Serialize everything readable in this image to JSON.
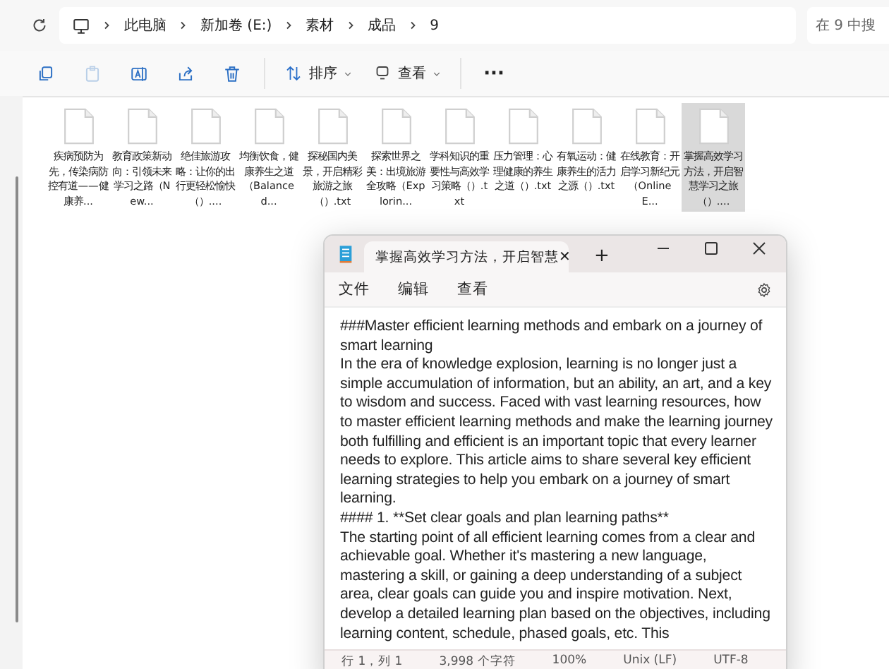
{
  "address_bar": {
    "crumbs": [
      "此电脑",
      "新加卷 (E:)",
      "素材",
      "成品",
      "9"
    ],
    "search": {
      "placeholder": "在 9 中搜"
    }
  },
  "toolbar": {
    "items": [
      {
        "kind": "copy",
        "disabled": false
      },
      {
        "kind": "paste",
        "disabled": true
      },
      {
        "kind": "rename",
        "disabled": false
      },
      {
        "kind": "share",
        "disabled": false
      },
      {
        "kind": "delete",
        "disabled": false
      }
    ],
    "sort": "排序",
    "view": "查看",
    "more": "···"
  },
  "files": [
    {
      "name": "疾病预防为先，传染病防控有道——健康养...",
      "selected": false
    },
    {
      "name": "教育政策新动向：引领未来学习之路（New...",
      "selected": false
    },
    {
      "name": "绝佳旅游攻略：让你的出行更轻松愉快（）....",
      "selected": false
    },
    {
      "name": "均衡饮食，健康养生之道（Balanced...",
      "selected": false
    },
    {
      "name": "探秘国内美景，开启精彩旅游之旅（）.txt",
      "selected": false
    },
    {
      "name": "探索世界之美：出境旅游全攻略（Explorin...",
      "selected": false
    },
    {
      "name": "学科知识的重要性与高效学习策略（）.txt",
      "selected": false
    },
    {
      "name": "压力管理：心理健康的养生之道（）.txt",
      "selected": false
    },
    {
      "name": "有氧运动：健康养生的活力之源（）.txt",
      "selected": false
    },
    {
      "name": "在线教育：开启学习新纪元（Online E...",
      "selected": false
    },
    {
      "name": "掌握高效学习方法，开启智慧学习之旅（）....",
      "selected": true
    }
  ],
  "notepad": {
    "tab_title": "掌握高效学习方法，开启智慧",
    "tab_close": "✕",
    "new_tab": "+",
    "menu": [
      "文件",
      "编辑",
      "查看"
    ],
    "body": [
      "###Master efficient learning methods and embark on a journey of smart learning",
      "In the era of knowledge explosion, learning is no longer just a simple accumulation of information, but an ability, an art, and a key to wisdom and success. Faced with vast learning resources, how to master efficient learning methods and make the learning journey both fulfilling and efficient is an important topic that every learner needs to explore. This article aims to share several key efficient learning strategies to help you embark on a journey of smart learning.",
      "#### 1. **Set clear goals and plan learning paths**",
      "The starting point of all efficient learning comes from a clear and achievable goal. Whether it's mastering a new language, mastering a skill, or gaining a deep understanding of a subject area, clear goals can guide you and inspire motivation. Next, develop a detailed learning plan based on the objectives, including learning content, schedule, phased goals, etc. This"
    ],
    "status": [
      "行 1，列 1",
      "3,998 个字符",
      "100%",
      "Unix (LF)",
      "UTF-8"
    ]
  }
}
